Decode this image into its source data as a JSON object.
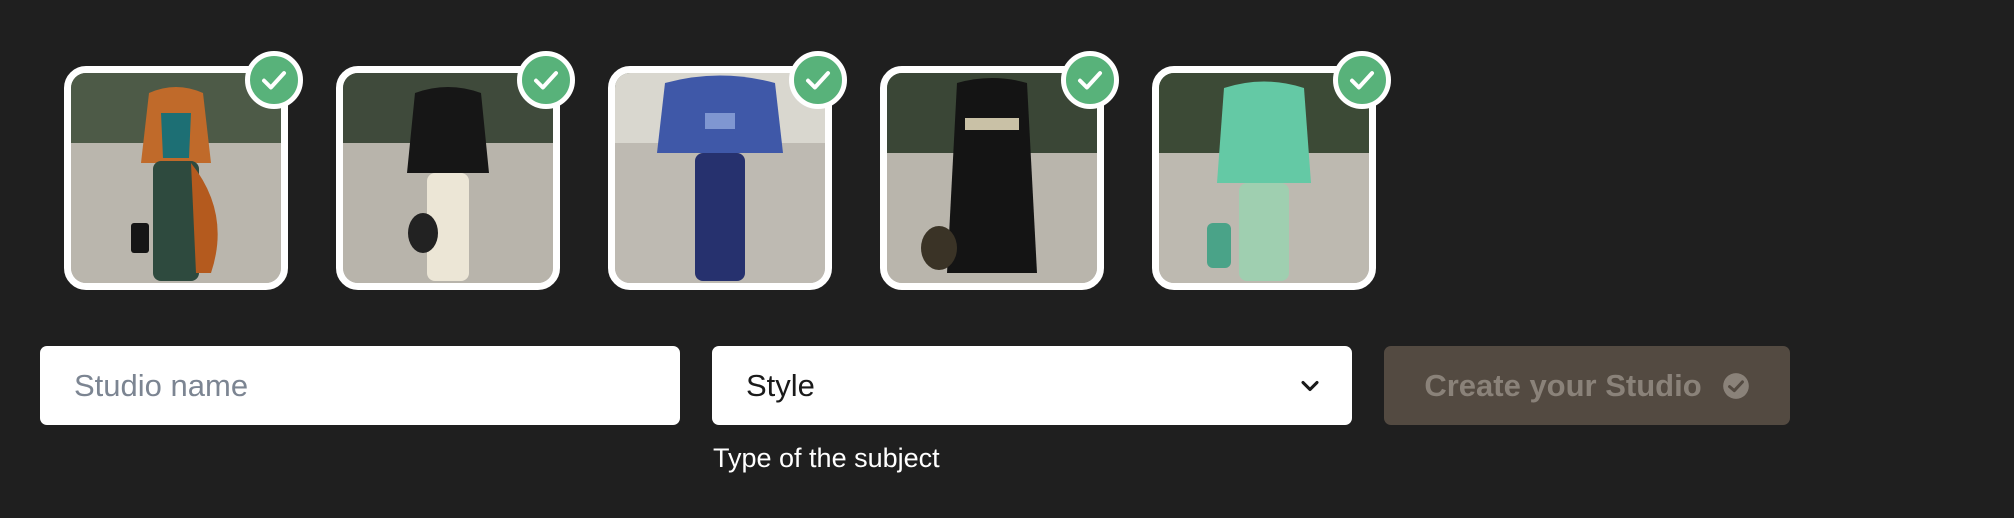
{
  "images": [
    {
      "description": "runway look 1",
      "palette": {
        "top": "#c06a2a",
        "bottom": "#2e4a3e",
        "accent": "#1d6f74"
      },
      "selected": true
    },
    {
      "description": "runway look 2",
      "palette": {
        "top": "#161616",
        "bottom": "#ece6d6",
        "accent": "#222222"
      },
      "selected": true
    },
    {
      "description": "runway look 3",
      "palette": {
        "top": "#3f58a8",
        "bottom": "#26316e",
        "accent": "#7f96d1"
      },
      "selected": true
    },
    {
      "description": "runway look 4",
      "palette": {
        "top": "#141414",
        "bottom": "#141414",
        "accent": "#c9c1a6"
      },
      "selected": true
    },
    {
      "description": "runway look 5",
      "palette": {
        "top": "#64c9a5",
        "bottom": "#9fcfb0",
        "accent": "#4aa388"
      },
      "selected": true
    }
  ],
  "form": {
    "name_placeholder": "Studio name",
    "name_value": "",
    "style_value": "Style",
    "style_helper": "Type of the subject",
    "create_label": "Create your Studio",
    "create_enabled": false
  },
  "icons": {
    "selected": "check-icon",
    "dropdown": "chevron-down-icon",
    "create": "check-circle-icon"
  },
  "colors": {
    "background": "#1f1f1f",
    "check": "#58b27a",
    "create_button": "#534a41",
    "create_text": "#8a8279"
  }
}
